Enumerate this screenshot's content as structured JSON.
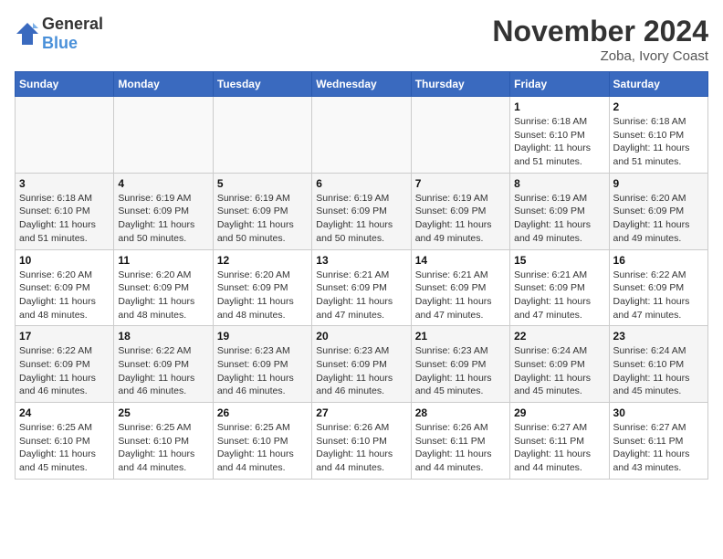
{
  "logo": {
    "text_general": "General",
    "text_blue": "Blue"
  },
  "header": {
    "month": "November 2024",
    "location": "Zoba, Ivory Coast"
  },
  "weekdays": [
    "Sunday",
    "Monday",
    "Tuesday",
    "Wednesday",
    "Thursday",
    "Friday",
    "Saturday"
  ],
  "weeks": [
    [
      {
        "day": "",
        "info": ""
      },
      {
        "day": "",
        "info": ""
      },
      {
        "day": "",
        "info": ""
      },
      {
        "day": "",
        "info": ""
      },
      {
        "day": "",
        "info": ""
      },
      {
        "day": "1",
        "info": "Sunrise: 6:18 AM\nSunset: 6:10 PM\nDaylight: 11 hours\nand 51 minutes."
      },
      {
        "day": "2",
        "info": "Sunrise: 6:18 AM\nSunset: 6:10 PM\nDaylight: 11 hours\nand 51 minutes."
      }
    ],
    [
      {
        "day": "3",
        "info": "Sunrise: 6:18 AM\nSunset: 6:10 PM\nDaylight: 11 hours\nand 51 minutes."
      },
      {
        "day": "4",
        "info": "Sunrise: 6:19 AM\nSunset: 6:09 PM\nDaylight: 11 hours\nand 50 minutes."
      },
      {
        "day": "5",
        "info": "Sunrise: 6:19 AM\nSunset: 6:09 PM\nDaylight: 11 hours\nand 50 minutes."
      },
      {
        "day": "6",
        "info": "Sunrise: 6:19 AM\nSunset: 6:09 PM\nDaylight: 11 hours\nand 50 minutes."
      },
      {
        "day": "7",
        "info": "Sunrise: 6:19 AM\nSunset: 6:09 PM\nDaylight: 11 hours\nand 49 minutes."
      },
      {
        "day": "8",
        "info": "Sunrise: 6:19 AM\nSunset: 6:09 PM\nDaylight: 11 hours\nand 49 minutes."
      },
      {
        "day": "9",
        "info": "Sunrise: 6:20 AM\nSunset: 6:09 PM\nDaylight: 11 hours\nand 49 minutes."
      }
    ],
    [
      {
        "day": "10",
        "info": "Sunrise: 6:20 AM\nSunset: 6:09 PM\nDaylight: 11 hours\nand 48 minutes."
      },
      {
        "day": "11",
        "info": "Sunrise: 6:20 AM\nSunset: 6:09 PM\nDaylight: 11 hours\nand 48 minutes."
      },
      {
        "day": "12",
        "info": "Sunrise: 6:20 AM\nSunset: 6:09 PM\nDaylight: 11 hours\nand 48 minutes."
      },
      {
        "day": "13",
        "info": "Sunrise: 6:21 AM\nSunset: 6:09 PM\nDaylight: 11 hours\nand 47 minutes."
      },
      {
        "day": "14",
        "info": "Sunrise: 6:21 AM\nSunset: 6:09 PM\nDaylight: 11 hours\nand 47 minutes."
      },
      {
        "day": "15",
        "info": "Sunrise: 6:21 AM\nSunset: 6:09 PM\nDaylight: 11 hours\nand 47 minutes."
      },
      {
        "day": "16",
        "info": "Sunrise: 6:22 AM\nSunset: 6:09 PM\nDaylight: 11 hours\nand 47 minutes."
      }
    ],
    [
      {
        "day": "17",
        "info": "Sunrise: 6:22 AM\nSunset: 6:09 PM\nDaylight: 11 hours\nand 46 minutes."
      },
      {
        "day": "18",
        "info": "Sunrise: 6:22 AM\nSunset: 6:09 PM\nDaylight: 11 hours\nand 46 minutes."
      },
      {
        "day": "19",
        "info": "Sunrise: 6:23 AM\nSunset: 6:09 PM\nDaylight: 11 hours\nand 46 minutes."
      },
      {
        "day": "20",
        "info": "Sunrise: 6:23 AM\nSunset: 6:09 PM\nDaylight: 11 hours\nand 46 minutes."
      },
      {
        "day": "21",
        "info": "Sunrise: 6:23 AM\nSunset: 6:09 PM\nDaylight: 11 hours\nand 45 minutes."
      },
      {
        "day": "22",
        "info": "Sunrise: 6:24 AM\nSunset: 6:09 PM\nDaylight: 11 hours\nand 45 minutes."
      },
      {
        "day": "23",
        "info": "Sunrise: 6:24 AM\nSunset: 6:10 PM\nDaylight: 11 hours\nand 45 minutes."
      }
    ],
    [
      {
        "day": "24",
        "info": "Sunrise: 6:25 AM\nSunset: 6:10 PM\nDaylight: 11 hours\nand 45 minutes."
      },
      {
        "day": "25",
        "info": "Sunrise: 6:25 AM\nSunset: 6:10 PM\nDaylight: 11 hours\nand 44 minutes."
      },
      {
        "day": "26",
        "info": "Sunrise: 6:25 AM\nSunset: 6:10 PM\nDaylight: 11 hours\nand 44 minutes."
      },
      {
        "day": "27",
        "info": "Sunrise: 6:26 AM\nSunset: 6:10 PM\nDaylight: 11 hours\nand 44 minutes."
      },
      {
        "day": "28",
        "info": "Sunrise: 6:26 AM\nSunset: 6:11 PM\nDaylight: 11 hours\nand 44 minutes."
      },
      {
        "day": "29",
        "info": "Sunrise: 6:27 AM\nSunset: 6:11 PM\nDaylight: 11 hours\nand 44 minutes."
      },
      {
        "day": "30",
        "info": "Sunrise: 6:27 AM\nSunset: 6:11 PM\nDaylight: 11 hours\nand 43 minutes."
      }
    ]
  ]
}
